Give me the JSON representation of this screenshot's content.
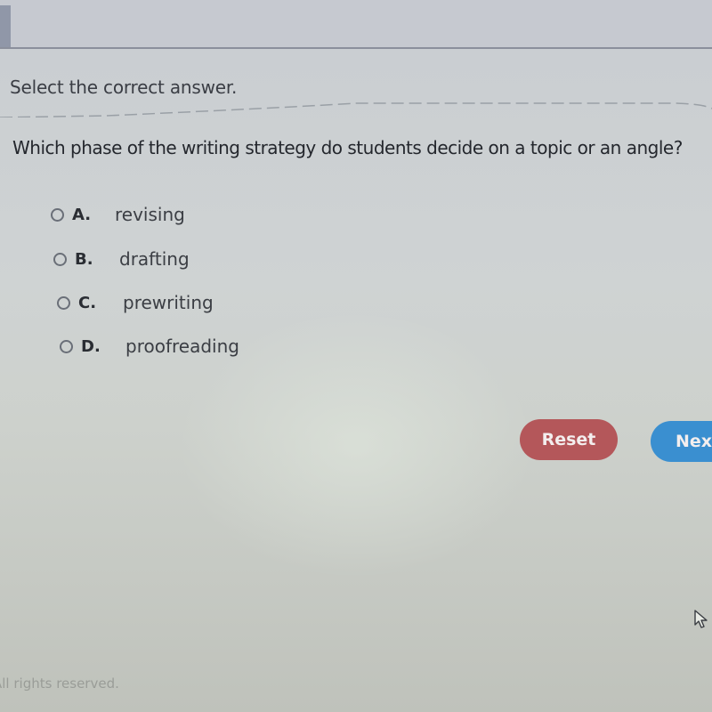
{
  "instruction": "Select the correct answer.",
  "question": "Which phase of the writing strategy do students decide on a topic or an angle?",
  "options": [
    {
      "letter": "A.",
      "text": "revising",
      "selected": false
    },
    {
      "letter": "B.",
      "text": "drafting",
      "selected": false
    },
    {
      "letter": "C.",
      "text": "prewriting",
      "selected": false
    },
    {
      "letter": "D.",
      "text": "proofreading",
      "selected": false
    }
  ],
  "buttons": {
    "reset_label": "Reset",
    "next_label": "Next"
  },
  "footer": {
    "text": "All rights reserved."
  },
  "colors": {
    "reset_button": "#b4575a",
    "next_button": "#3a8fd0"
  },
  "icons": {
    "cursor": "mouse-pointer-arrow",
    "radio": "radio-button-unchecked"
  }
}
